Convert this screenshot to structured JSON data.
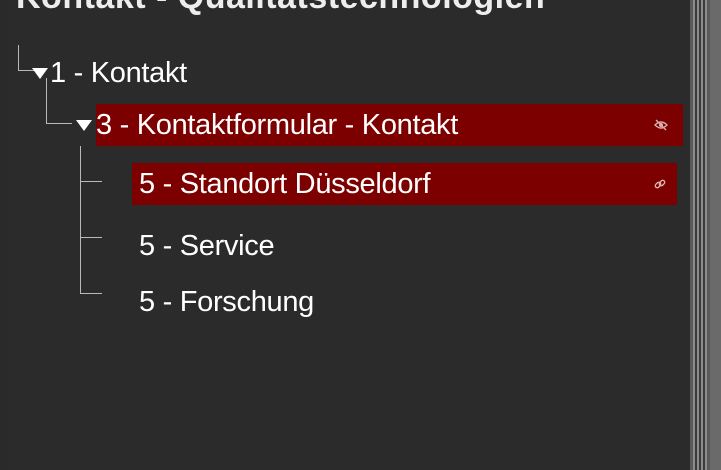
{
  "header": {
    "title": "Kontakt - Qualitätstechnologien"
  },
  "tree": {
    "items": [
      {
        "label": "1 - Kontakt"
      },
      {
        "label": "3 - Kontaktformular - Kontakt",
        "status_icon": "eye-off-icon"
      },
      {
        "label": "5 - Standort Düsseldorf",
        "status_icon": "link-icon"
      },
      {
        "label": "5 - Service"
      },
      {
        "label": "5 - Forschung"
      }
    ]
  },
  "colors": {
    "selection": "#7d0000",
    "background": "#2b2b2b",
    "tree_line": "#b9b9b9"
  }
}
